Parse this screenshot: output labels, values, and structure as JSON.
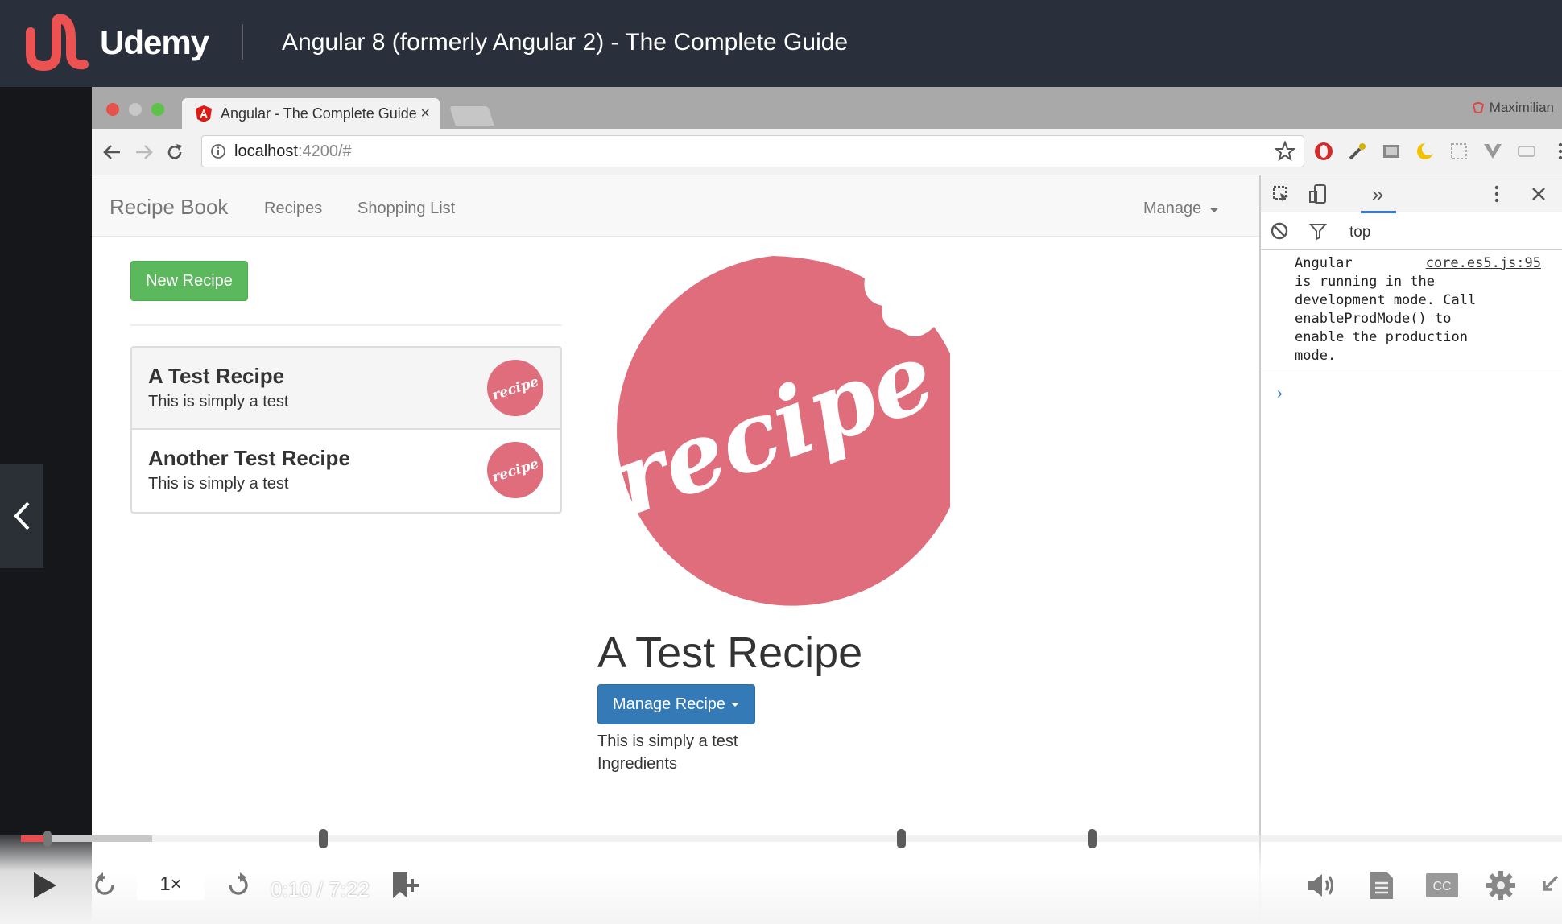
{
  "header": {
    "brand": "Udemy",
    "course_title": "Angular 8 (formerly Angular 2) - The Complete Guide"
  },
  "browser": {
    "tab_title": "Angular - The Complete Guide",
    "tab_close": "×",
    "profile_name": "Maximilian",
    "url_host": "localhost",
    "url_path": ":4200/#"
  },
  "app": {
    "brand": "Recipe Book",
    "nav": {
      "recipes": "Recipes",
      "shopping_list": "Shopping List",
      "manage": "Manage"
    },
    "new_recipe_label": "New Recipe",
    "recipes": [
      {
        "name": "A Test Recipe",
        "description": "This is simply a test"
      },
      {
        "name": "Another Test Recipe",
        "description": "This is simply a test"
      }
    ],
    "detail": {
      "title": "A Test Recipe",
      "manage_label": "Manage Recipe",
      "description": "This is simply a test",
      "ingredients_label": "Ingredients"
    },
    "image_word": "recipe"
  },
  "devtools": {
    "context": "top",
    "more_tabs": "»",
    "console_source": "core.es5.js:95",
    "console_message": "Angular\nis running in the\ndevelopment mode. Call\nenableProdMode() to\nenable the production\nmode.",
    "prompt": "›"
  },
  "player": {
    "speed_label": "1×",
    "time": "0:10 / 7:22",
    "played_fraction": 0.018,
    "buffered_fraction": 0.085,
    "bookmark_fractions": [
      0.196,
      0.571,
      0.695
    ],
    "colors": {
      "played": "#e94d4d",
      "header_bg": "#29303b",
      "udemy_red": "#ec5252",
      "recipe_pink": "#e06d7c"
    }
  }
}
